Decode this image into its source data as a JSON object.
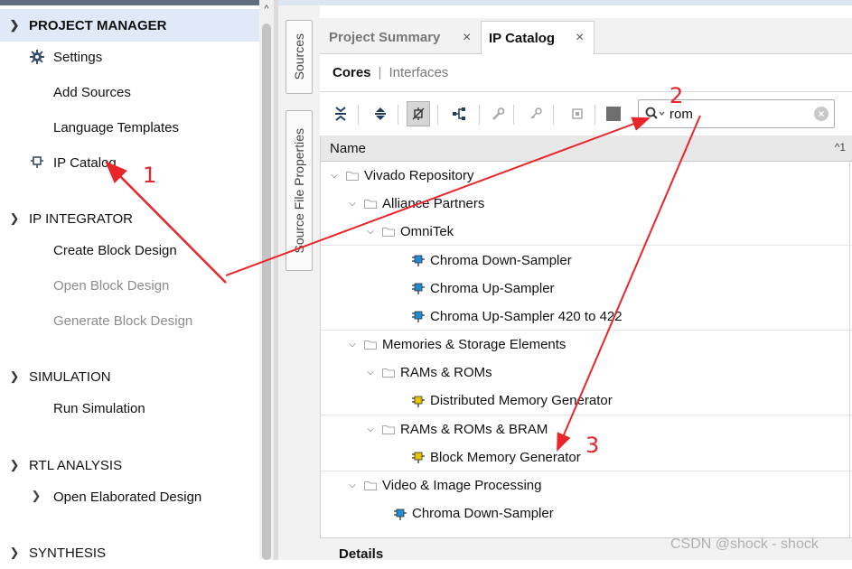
{
  "navigator": {
    "sections": [
      {
        "title": "PROJECT MANAGER",
        "items": [
          "Settings",
          "Add Sources",
          "Language Templates",
          "IP Catalog"
        ]
      },
      {
        "title": "IP INTEGRATOR",
        "items": [
          "Create Block Design",
          "Open Block Design",
          "Generate Block Design"
        ]
      },
      {
        "title": "SIMULATION",
        "items": [
          "Run Simulation"
        ]
      },
      {
        "title": "RTL ANALYSIS",
        "items": [
          "Open Elaborated Design"
        ]
      },
      {
        "title": "SYNTHESIS",
        "items": []
      }
    ],
    "disabled_items": [
      "Open Block Design",
      "Generate Block Design"
    ]
  },
  "side_tabs": {
    "sources": "Sources",
    "source_file_properties": "Source File Properties"
  },
  "tabs": [
    {
      "label": "Project Summary",
      "active": false
    },
    {
      "label": "IP Catalog",
      "active": true
    }
  ],
  "subtabs": {
    "cores": "Cores",
    "separator": "|",
    "interfaces": "Interfaces"
  },
  "search": {
    "value": "rom",
    "placeholder": ""
  },
  "tree": {
    "column_name": "Name",
    "sort_indicator": "^1",
    "rows": [
      {
        "label": "Vivado Repository",
        "type": "folder",
        "level": 0
      },
      {
        "label": "Alliance Partners",
        "type": "folder",
        "level": 1
      },
      {
        "label": "OmniTek",
        "type": "folder",
        "level": 2
      },
      {
        "label": "Chroma Down-Sampler",
        "type": "ip",
        "level": 3
      },
      {
        "label": "Chroma Up-Sampler",
        "type": "ip",
        "level": 3
      },
      {
        "label": "Chroma Up-Sampler 420 to 422",
        "type": "ip",
        "level": 3
      },
      {
        "label": "Memories & Storage Elements",
        "type": "folder",
        "level": 1
      },
      {
        "label": "RAMs & ROMs",
        "type": "folder",
        "level": 2
      },
      {
        "label": "Distributed Memory Generator",
        "type": "ip-yellow",
        "level": 3
      },
      {
        "label": "RAMs & ROMs & BRAM",
        "type": "folder",
        "level": 2
      },
      {
        "label": "Block Memory Generator",
        "type": "ip-yellow",
        "level": 3
      },
      {
        "label": "Video & Image Processing",
        "type": "folder",
        "level": 1
      },
      {
        "label": "Chroma Down-Sampler",
        "type": "ip",
        "level": 2
      }
    ]
  },
  "details": {
    "label": "Details"
  },
  "annotations": {
    "one": "1",
    "two": "2",
    "three": "3"
  },
  "watermark": "CSDN @shock - shock",
  "colors": {
    "annotation_red": "#e8262a",
    "selection_blue": "#dfe9f7",
    "ip_blue": "#1f8dd6",
    "ip_yellow": "#e8c400"
  }
}
